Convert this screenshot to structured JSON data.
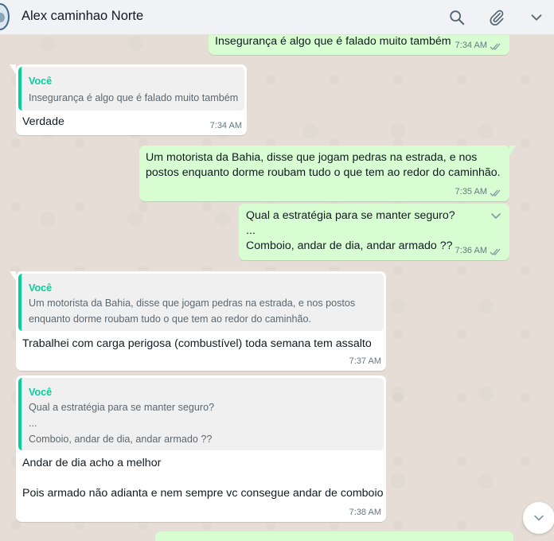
{
  "header": {
    "contact_name": "Alex caminhao Norte",
    "icons": [
      "search-icon",
      "attach-icon",
      "chevron-down-icon"
    ]
  },
  "messages": [
    {
      "direction": "out",
      "text": "Insegurança é algo que é falado muito também",
      "time": "7:34 AM",
      "status": "read"
    },
    {
      "direction": "in",
      "quote": {
        "author": "Você",
        "text": "Insegurança é algo que é falado muito também"
      },
      "text": "Verdade",
      "time": "7:34 AM"
    },
    {
      "direction": "out",
      "text": "Um motorista da Bahia, disse que jogam pedras na estrada, e nos\npostos enquanto dorme roubam tudo o que tem ao redor do caminhão.",
      "time": "7:35 AM",
      "status": "read"
    },
    {
      "direction": "out",
      "text": "Qual a estratégia para se manter seguro?\n...\nComboio, andar de dia, andar armado ??",
      "time": "7:36 AM",
      "status": "read"
    },
    {
      "direction": "in",
      "quote": {
        "author": "Você",
        "text": "Um motorista da Bahia, disse que jogam pedras na estrada, e nos postos\nenquanto dorme roubam tudo o que tem ao redor do caminhão."
      },
      "text": "Trabalhei com carga perigosa (combustível) toda semana tem assalto",
      "time": "7:37 AM"
    },
    {
      "direction": "in",
      "quote": {
        "author": "Você",
        "text": "Qual a estratégia para se manter seguro?\n...\nComboio, andar de dia, andar armado ??"
      },
      "text": "Andar de dia acho a melhor\n\nPois armado não adianta e nem sempre vc consegue andar de comboio",
      "time": "7:38 AM"
    }
  ],
  "colors": {
    "header_bg": "#f0f2f5",
    "chat_bg": "#e6ded6",
    "incoming_bubble": "#ffffff",
    "outgoing_bubble": "#d9fdd3",
    "quote_accent": "#06cf9c",
    "read_ticks": "#8696a0"
  }
}
